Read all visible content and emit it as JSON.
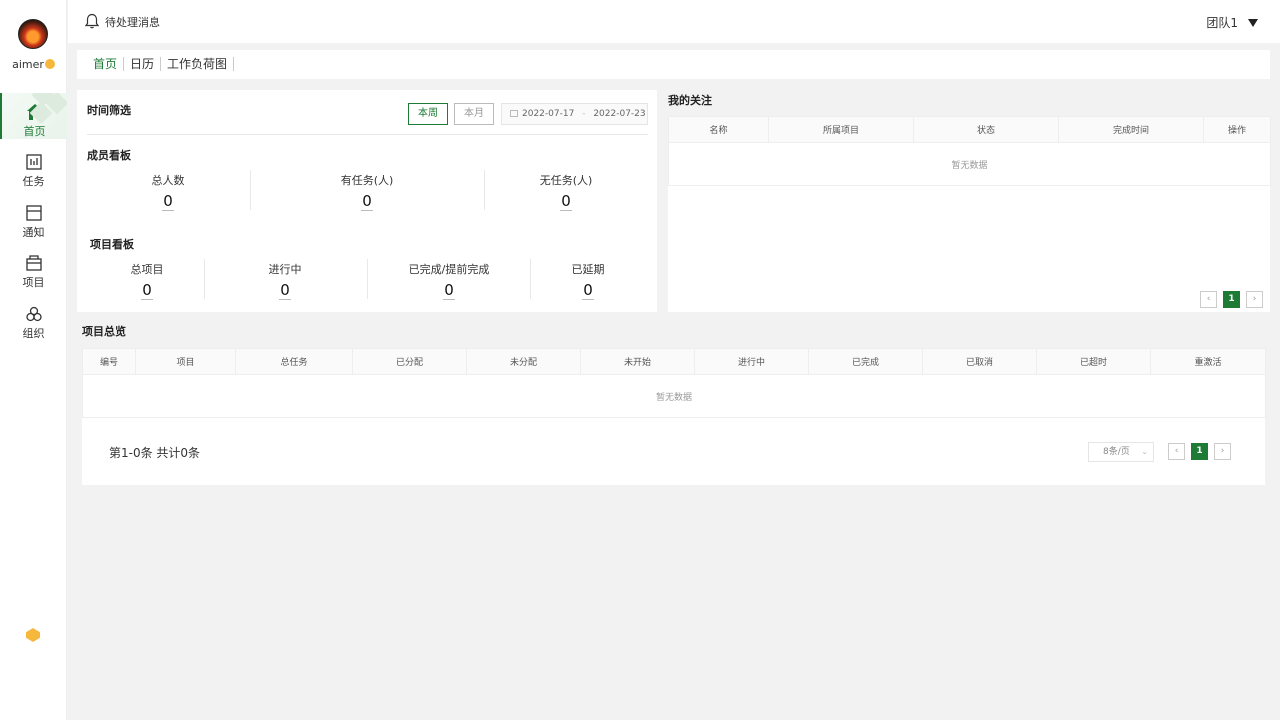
{
  "user": {
    "name": "aimer"
  },
  "nav": [
    {
      "label": "首页",
      "icon": "home-icon"
    },
    {
      "label": "任务",
      "icon": "task-icon"
    },
    {
      "label": "通知",
      "icon": "notification-icon"
    },
    {
      "label": "项目",
      "icon": "project-icon"
    },
    {
      "label": "组织",
      "icon": "organization-icon"
    }
  ],
  "header": {
    "pending_label": "待处理消息",
    "team": "团队1"
  },
  "tabs": [
    "首页",
    "日历",
    "工作负荷图"
  ],
  "time_filter": {
    "title": "时间筛选",
    "this_week": "本周",
    "this_month": "本月",
    "date_start": "2022-07-17",
    "date_sep": "-",
    "date_end": "2022-07-23"
  },
  "member_board": {
    "title": "成员看板",
    "stats": [
      {
        "label": "总人数",
        "value": "0"
      },
      {
        "label": "有任务(人)",
        "value": "0"
      },
      {
        "label": "无任务(人)",
        "value": "0"
      }
    ]
  },
  "project_board": {
    "title": "项目看板",
    "stats": [
      {
        "label": "总项目",
        "value": "0"
      },
      {
        "label": "进行中",
        "value": "0"
      },
      {
        "label": "已完成/提前完成",
        "value": "0"
      },
      {
        "label": "已延期",
        "value": "0"
      }
    ]
  },
  "my_focus": {
    "title": "我的关注",
    "columns": [
      "名称",
      "所属项目",
      "状态",
      "完成时间",
      "操作"
    ],
    "empty": "暂无数据",
    "page": "1"
  },
  "overview": {
    "title": "项目总览",
    "columns": [
      "编号",
      "项目",
      "总任务",
      "已分配",
      "未分配",
      "未开始",
      "进行中",
      "已完成",
      "已取消",
      "已超时",
      "重激活"
    ],
    "empty": "暂无数据",
    "total_text": "第1-0条 共计0条",
    "page_size": "8条/页",
    "page": "1"
  }
}
